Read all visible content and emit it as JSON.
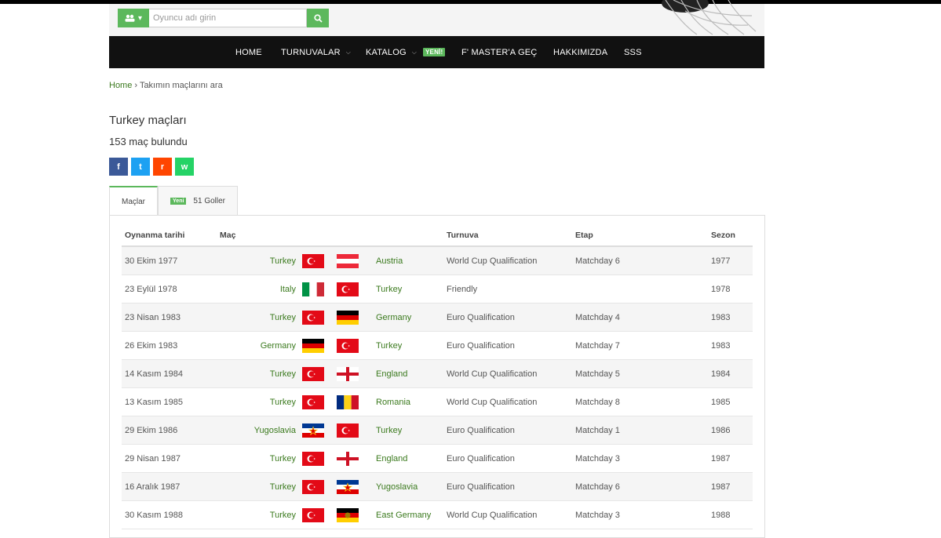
{
  "search": {
    "placeholder": "Oyuncu adı girin"
  },
  "nav": {
    "home": "HOME",
    "tournaments": "TURNUVALAR",
    "catalog": "KATALOG",
    "catalog_badge": "YENİ!",
    "master": "F' MASTER'A GEÇ",
    "about": "HAKKIMIZDA",
    "faq": "SSS"
  },
  "breadcrumb": {
    "home": "Home",
    "sep": "›",
    "current": "Takımın maçlarını ara"
  },
  "page": {
    "title": "Turkey maçları",
    "count": "153 maç bulundu"
  },
  "share": {
    "facebook": "f",
    "twitter": "t",
    "reddit": "r",
    "whatsapp": "w"
  },
  "tabs": {
    "matches": "Maçlar",
    "goals_badge": "Yeni",
    "goals": "51 Goller"
  },
  "table": {
    "headers": {
      "date": "Oynanma tarihi",
      "match": "Maç",
      "tournament": "Turnuva",
      "stage": "Etap",
      "season": "Sezon"
    },
    "rows": [
      {
        "date": "30 Ekim 1977",
        "home": "Turkey",
        "home_flag": "turkey",
        "away_flag": "austria",
        "away": "Austria",
        "tournament": "World Cup Qualification",
        "stage": "Matchday 6",
        "season": "1977"
      },
      {
        "date": "23 Eylül 1978",
        "home": "Italy",
        "home_flag": "italy",
        "away_flag": "turkey",
        "away": "Turkey",
        "tournament": "Friendly",
        "stage": "",
        "season": "1978"
      },
      {
        "date": "23 Nisan 1983",
        "home": "Turkey",
        "home_flag": "turkey",
        "away_flag": "germany",
        "away": "Germany",
        "tournament": "Euro Qualification",
        "stage": "Matchday 4",
        "season": "1983"
      },
      {
        "date": "26 Ekim 1983",
        "home": "Germany",
        "home_flag": "germany",
        "away_flag": "turkey",
        "away": "Turkey",
        "tournament": "Euro Qualification",
        "stage": "Matchday 7",
        "season": "1983"
      },
      {
        "date": "14 Kasım 1984",
        "home": "Turkey",
        "home_flag": "turkey",
        "away_flag": "england",
        "away": "England",
        "tournament": "World Cup Qualification",
        "stage": "Matchday 5",
        "season": "1984"
      },
      {
        "date": "13 Kasım 1985",
        "home": "Turkey",
        "home_flag": "turkey",
        "away_flag": "romania",
        "away": "Romania",
        "tournament": "World Cup Qualification",
        "stage": "Matchday 8",
        "season": "1985"
      },
      {
        "date": "29 Ekim 1986",
        "home": "Yugoslavia",
        "home_flag": "yugoslavia",
        "away_flag": "turkey",
        "away": "Turkey",
        "tournament": "Euro Qualification",
        "stage": "Matchday 1",
        "season": "1986"
      },
      {
        "date": "29 Nisan 1987",
        "home": "Turkey",
        "home_flag": "turkey",
        "away_flag": "england",
        "away": "England",
        "tournament": "Euro Qualification",
        "stage": "Matchday 3",
        "season": "1987"
      },
      {
        "date": "16 Aralık 1987",
        "home": "Turkey",
        "home_flag": "turkey",
        "away_flag": "yugoslavia",
        "away": "Yugoslavia",
        "tournament": "Euro Qualification",
        "stage": "Matchday 6",
        "season": "1987"
      },
      {
        "date": "30 Kasım 1988",
        "home": "Turkey",
        "home_flag": "turkey",
        "away_flag": "east-germany",
        "away": "East Germany",
        "tournament": "World Cup Qualification",
        "stage": "Matchday 3",
        "season": "1988"
      }
    ]
  },
  "colors": {
    "accent": "#5cb85c",
    "link": "#3b7a1e",
    "nav_bg": "#111111"
  }
}
